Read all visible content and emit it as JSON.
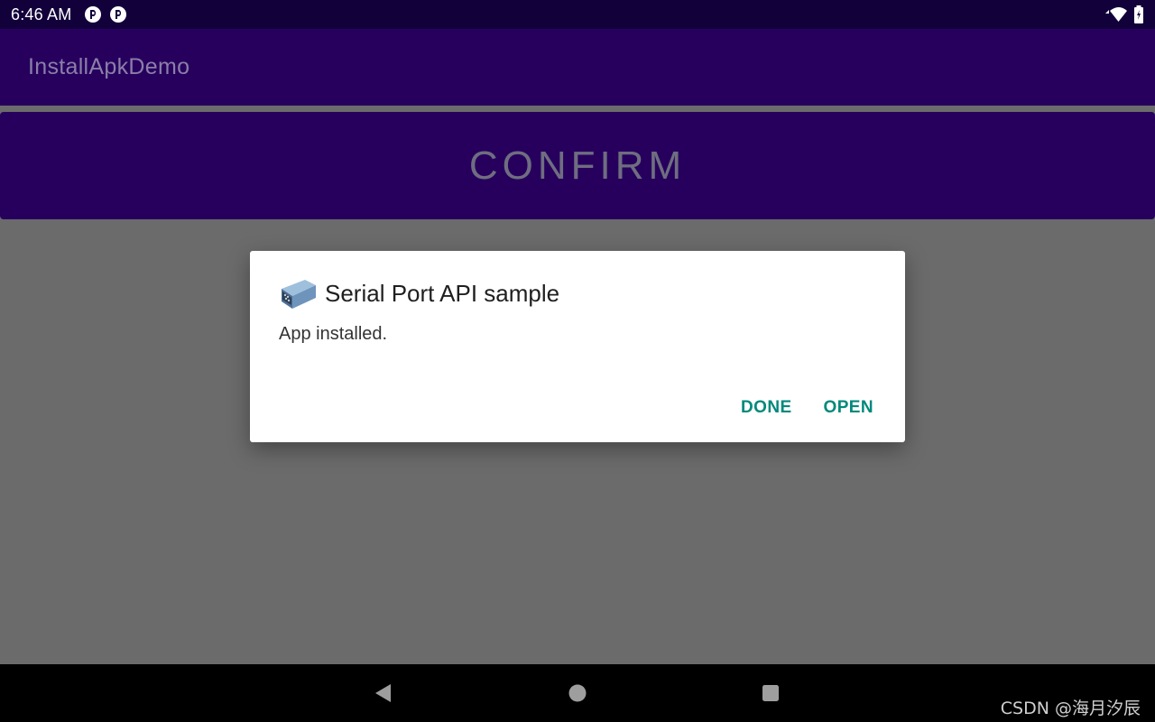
{
  "status_bar": {
    "time": "6:46 AM",
    "notification_icons": [
      "app-notification-icon",
      "app-notification-icon"
    ],
    "system_icons": [
      "wifi-icon",
      "battery-icon"
    ]
  },
  "app_bar": {
    "title": "InstallApkDemo"
  },
  "confirm_button": {
    "label": "CONFIRM"
  },
  "dialog": {
    "icon": "serial-port-app-icon",
    "title": "Serial Port API sample",
    "message": "App installed.",
    "done_label": "DONE",
    "open_label": "OPEN",
    "action_color": "#00897b"
  },
  "nav_bar": {
    "buttons": [
      "back-icon",
      "home-icon",
      "recents-icon"
    ]
  },
  "watermark": "CSDN @海月汐辰",
  "colors": {
    "status_bar": "#12003a",
    "app_bar": "#27005e",
    "scrim": "#6b6b6b"
  }
}
